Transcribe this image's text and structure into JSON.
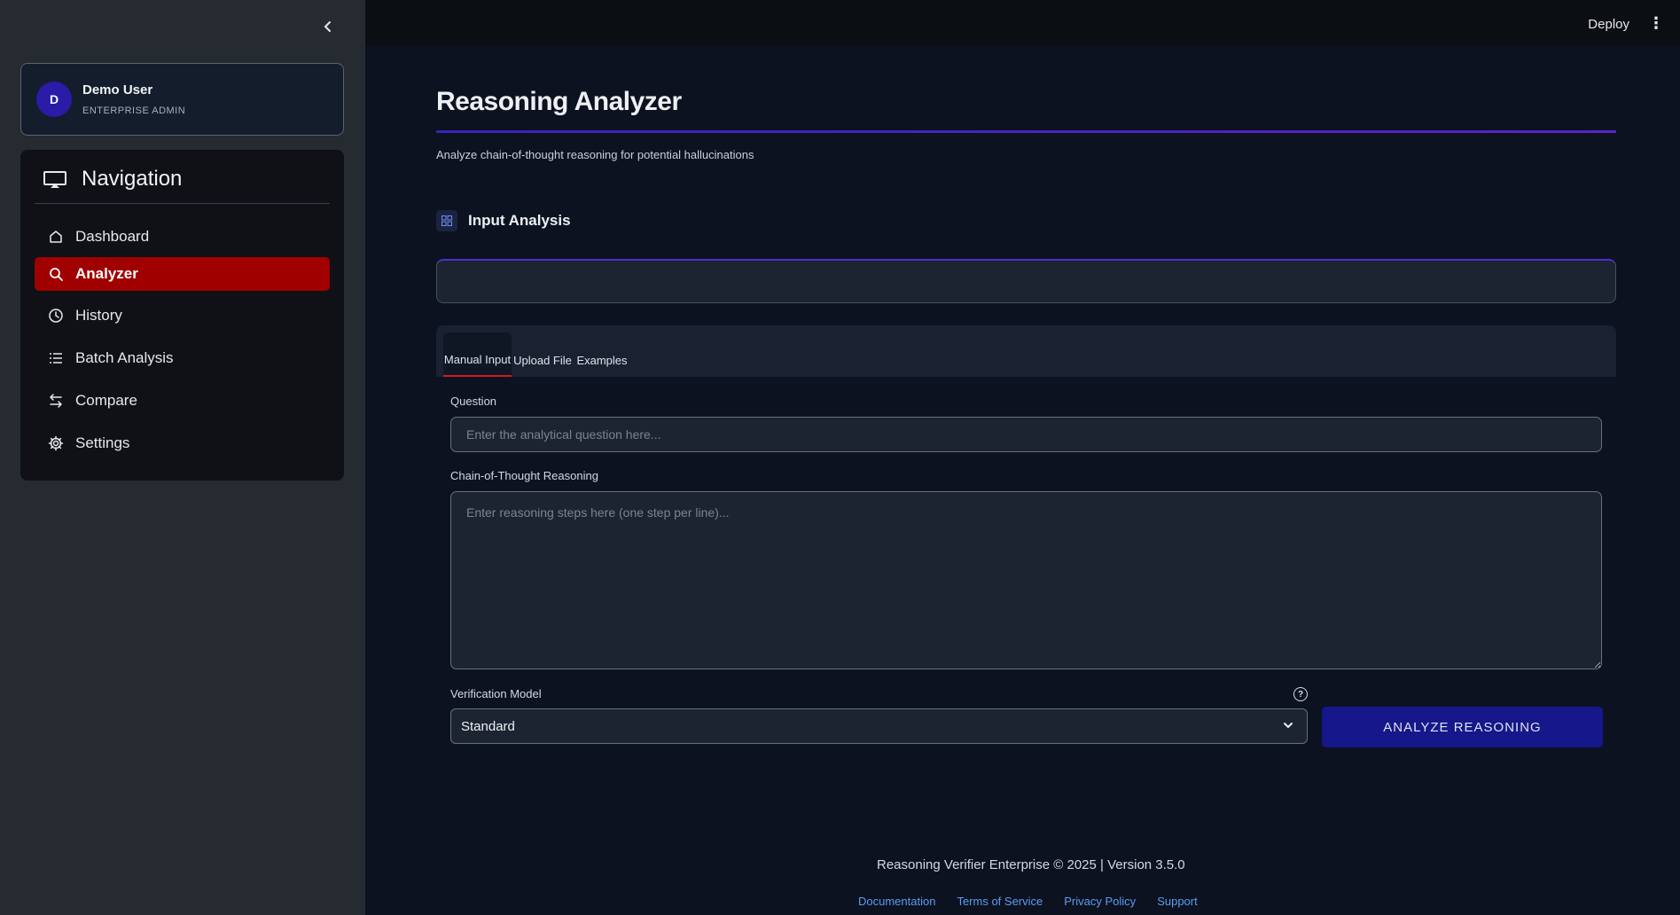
{
  "sidebar": {
    "user": {
      "initial": "D",
      "name": "Demo User",
      "role": "ENTERPRISE ADMIN"
    },
    "nav_title": "Navigation",
    "items": [
      {
        "label": "Dashboard",
        "icon": "home-icon",
        "active": false
      },
      {
        "label": "Analyzer",
        "icon": "search-icon",
        "active": true
      },
      {
        "label": "History",
        "icon": "clock-icon",
        "active": false
      },
      {
        "label": "Batch Analysis",
        "icon": "list-icon",
        "active": false
      },
      {
        "label": "Compare",
        "icon": "swap-icon",
        "active": false
      },
      {
        "label": "Settings",
        "icon": "gear-icon",
        "active": false
      }
    ],
    "active_color": "#a00000"
  },
  "topbar": {
    "deploy_label": "Deploy"
  },
  "main": {
    "title": "Reasoning Analyzer",
    "subtitle": "Analyze chain-of-thought reasoning for potential hallucinations",
    "section_title": "Input Analysis",
    "tabs": [
      {
        "label": "Manual Input",
        "active": true
      },
      {
        "label": "Upload File",
        "active": false
      },
      {
        "label": "Examples",
        "active": false
      }
    ],
    "question_label": "Question",
    "question_placeholder": "Enter the analytical question here...",
    "reasoning_label": "Chain-of-Thought Reasoning",
    "reasoning_placeholder": "Enter reasoning steps here (one step per line)...",
    "model_label": "Verification Model",
    "model_value": "Standard",
    "analyze_label": "ANALYZE REASONING",
    "accent": "#4b2fd0",
    "button_color": "#15178a"
  },
  "footer": {
    "text": "Reasoning Verifier Enterprise © 2025 | Version 3.5.0",
    "links": [
      "Documentation",
      "Terms of Service",
      "Privacy Policy",
      "Support"
    ],
    "link_color": "#5b9cf0"
  }
}
